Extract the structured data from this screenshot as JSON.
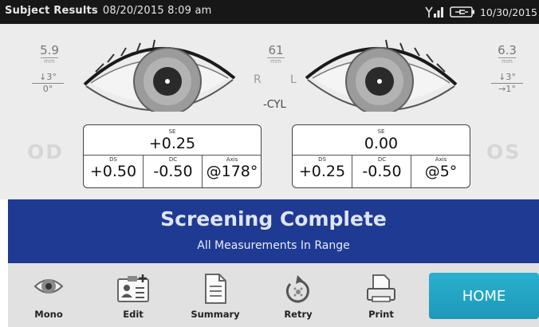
{
  "status_bar": {
    "title": "Subject Results",
    "timestamp": "08/20/2015 8:09 am",
    "date_right": "10/30/2015"
  },
  "right_eye": {
    "label": "OD",
    "measure_value": "5.9",
    "measure_unit": "mm",
    "axis_top": "↓3°",
    "axis_bottom": "0°",
    "letter": "R",
    "result": {
      "se_label": "SE",
      "se": "+0.25",
      "ds_label": "DS",
      "ds": "+0.50",
      "dc_label": "DC",
      "dc": "-0.50",
      "axis_label": "Axis",
      "axis": "@178°"
    }
  },
  "left_eye": {
    "label": "OS",
    "measure_value": "6.3",
    "measure_unit": "mm",
    "axis_top": "↓3°",
    "axis_bottom": "→1°",
    "letter": "L",
    "result": {
      "se_label": "SE",
      "se": "0.00",
      "ds_label": "DS",
      "ds": "+0.25",
      "dc_label": "DC",
      "dc": "-0.50",
      "axis_label": "Axis",
      "axis": "@5°"
    }
  },
  "center": {
    "pd_value": "61",
    "pd_unit": "mm",
    "cyl_label": "-CYL"
  },
  "banner": {
    "title": "Screening Complete",
    "subtitle": "All Measurements In Range"
  },
  "toolbar": {
    "mono": "Mono",
    "edit": "Edit",
    "summary": "Summary",
    "retry": "Retry",
    "print": "Print",
    "home": "HOME"
  },
  "colors": {
    "banner": "#1f3a93",
    "home_button": "#24a6c6",
    "status_bar": "#171717",
    "iris": "#9b9b9b"
  }
}
